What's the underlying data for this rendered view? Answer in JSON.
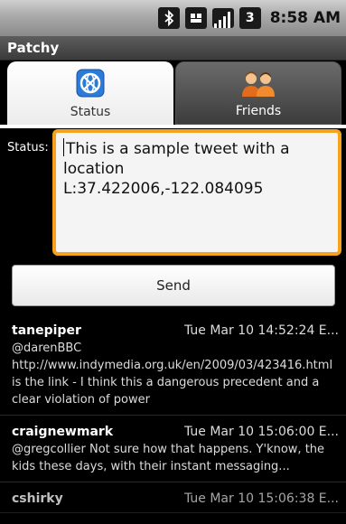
{
  "status_bar": {
    "time": "8:58 AM",
    "icons": [
      "bluetooth-icon",
      "usb-icon",
      "signal-icon",
      "battery-icon"
    ],
    "battery_label": "3"
  },
  "app": {
    "title": "Patchy"
  },
  "tabs": [
    {
      "label": "Status",
      "icon": "globe-icon",
      "selected": true
    },
    {
      "label": "Friends",
      "icon": "people-icon",
      "selected": false
    }
  ],
  "form": {
    "status_label": "Status:",
    "status_value": "This is a sample tweet with a location\nL:37.422006,-122.084095",
    "send_label": "Send"
  },
  "timeline": [
    {
      "user": "tanepiper",
      "time": "Tue Mar 10 14:52:24 E...",
      "text": "@darenBBC http://www.indymedia.org.uk/en/2009/03/423416.html is the link - I think this a dangerous precedent and a clear violation of power"
    },
    {
      "user": "craignewmark",
      "time": "Tue Mar 10 15:06:00 E...",
      "text": "@gregcollier Not sure how that happens. Y'know, the kids these days, with their instant messaging..."
    },
    {
      "user": "cshirky",
      "time": "Tue Mar 10 15:06:38 E...",
      "text": ""
    }
  ],
  "colors": {
    "focus_border": "#f7a21c",
    "status_bar": "#a9a9a9",
    "title_bar": "#3b3b3b",
    "background": "#000000"
  }
}
